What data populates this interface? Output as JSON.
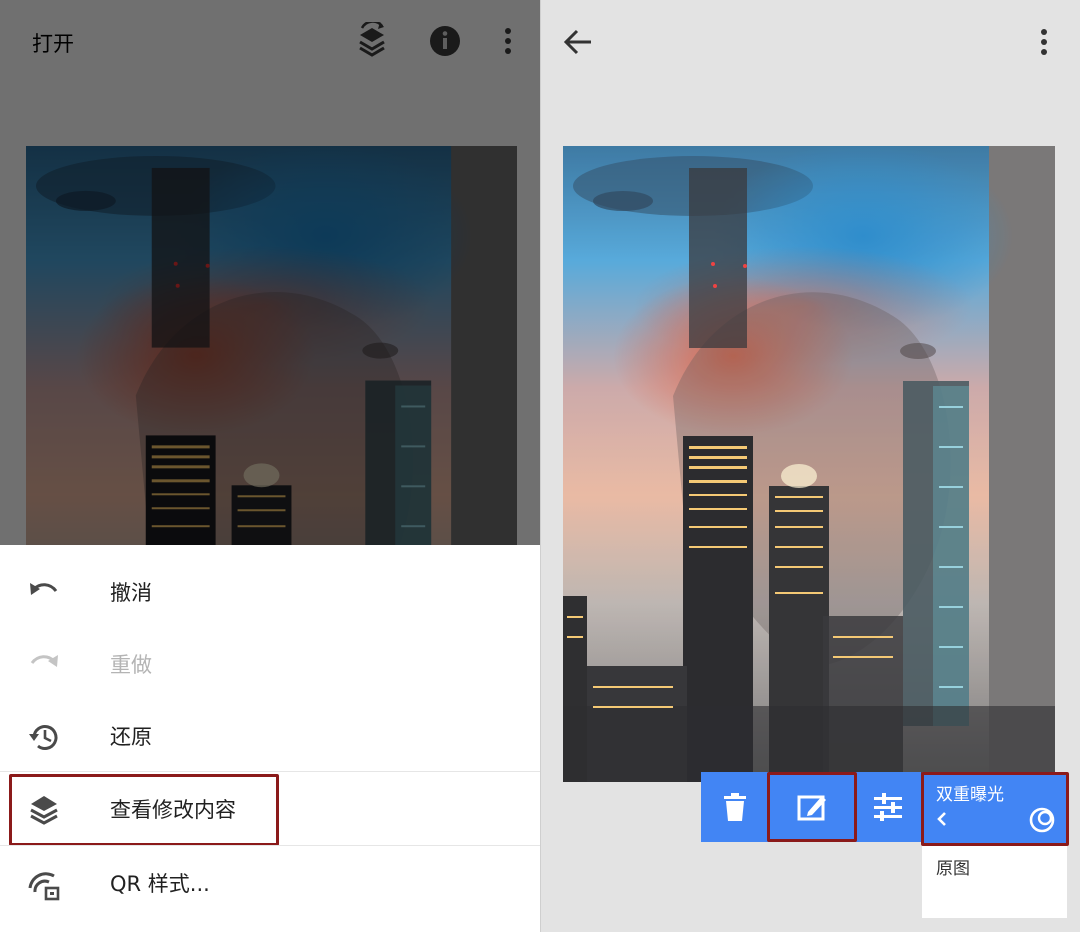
{
  "left_panel": {
    "topbar": {
      "open_label": "打开",
      "icons": [
        "layers-rotate-icon",
        "info-icon",
        "more-vert-icon"
      ]
    },
    "menu": {
      "items": [
        {
          "label": "撤消",
          "icon": "undo-icon",
          "enabled": true
        },
        {
          "label": "重做",
          "icon": "redo-icon",
          "enabled": false
        },
        {
          "label": "还原",
          "icon": "history-icon",
          "enabled": true
        },
        {
          "label": "查看修改内容",
          "icon": "layers-icon",
          "enabled": true,
          "highlighted": true
        },
        {
          "label": "QR 样式...",
          "icon": "qr-style-icon",
          "enabled": true
        }
      ]
    }
  },
  "right_panel": {
    "topbar": {
      "icons": [
        "back-arrow-icon",
        "more-vert-icon"
      ]
    },
    "edit_stack": {
      "tools": [
        {
          "name": "delete-icon"
        },
        {
          "name": "brush-edit-icon",
          "highlighted": true
        },
        {
          "name": "tune-sliders-icon"
        }
      ],
      "layers": [
        {
          "label": "双重曝光",
          "selected": true,
          "highlighted": true
        },
        {
          "label": "原图",
          "selected": false
        }
      ]
    }
  },
  "colors": {
    "accent": "#4285f4",
    "highlight_border": "#8b1a1a",
    "disabled_text": "#b4b4b4"
  }
}
